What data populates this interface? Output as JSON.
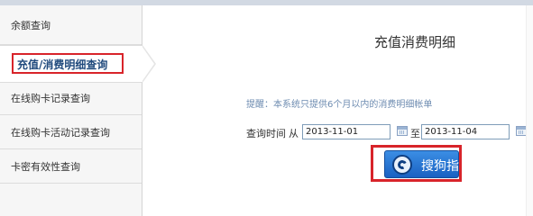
{
  "sidebar": {
    "items": [
      {
        "label": "余额查询"
      },
      {
        "label": "充值/消费明细查询"
      },
      {
        "label": "在线购卡记录查询"
      },
      {
        "label": "在线购卡活动记录查询"
      },
      {
        "label": "卡密有效性查询"
      }
    ],
    "active_index": 1
  },
  "main": {
    "title": "充值消费明细",
    "tip": "提醒：本系统只提供6个月以内的消费明细帐单",
    "query_label": "查询时间",
    "from_label": "从",
    "to_label": "至",
    "start_date": "2013-11-01",
    "end_date": "2013-11-04",
    "query_button_label": "搜狗指南",
    "calendar_icon": "calendar-icon"
  },
  "colors": {
    "highlight": "#d8242a",
    "button": "#1a61c2",
    "active_text": "#204a7d",
    "tip_text": "#6e8cb1"
  }
}
